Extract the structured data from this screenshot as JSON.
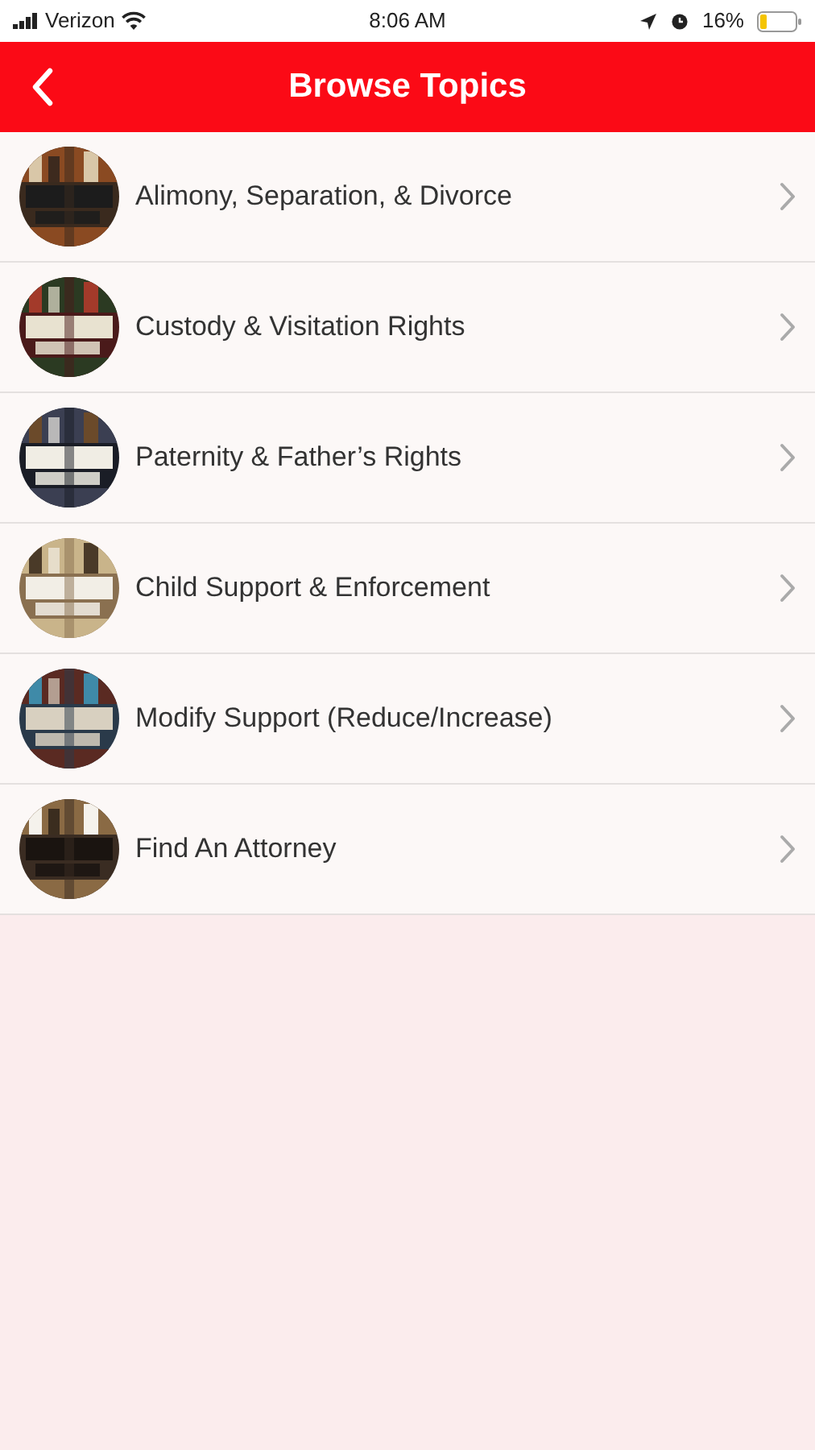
{
  "status_bar": {
    "carrier": "Verizon",
    "time": "8:06 AM",
    "battery": "16%"
  },
  "header": {
    "title": "Browse Topics"
  },
  "topics": [
    {
      "title": "Alimony, Separation, & Divorce"
    },
    {
      "title": "Custody & Visitation Rights"
    },
    {
      "title": "Paternity & Father’s Rights"
    },
    {
      "title": "Child Support & Enforcement"
    },
    {
      "title": "Modify Support (Reduce/Increase)"
    },
    {
      "title": "Find An Attorney"
    }
  ]
}
